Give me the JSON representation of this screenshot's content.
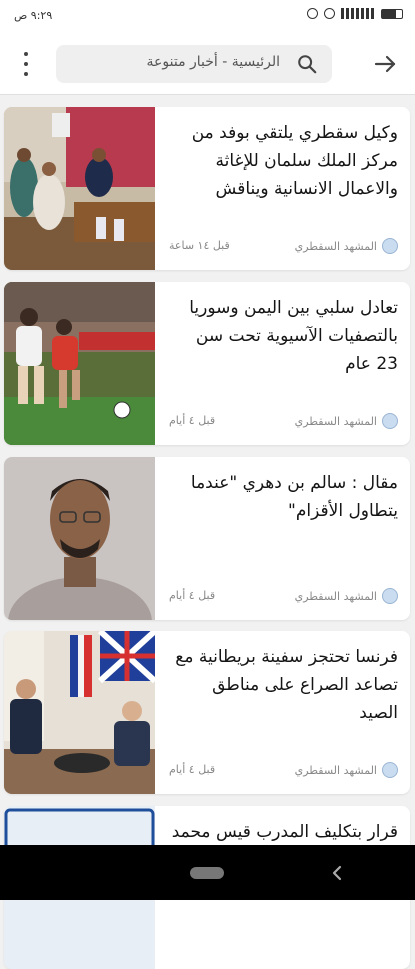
{
  "status_bar": {
    "time": "٩:٢٩ ص"
  },
  "header": {
    "search_text": "الرئيسية - أخبار متنوعة"
  },
  "articles": [
    {
      "title": "وكيل سقطري يلتقي بوفد من مركز الملك سلمان للإغاثة والاعمال الانسانية ويناقش",
      "source": "المشهد السقطري",
      "time": "قبل ١٤ ساعة"
    },
    {
      "title": "تعادل سلبي بين اليمن وسوريا بالتصفيات الآسيوية تحت سن 23 عام",
      "source": "المشهد السقطري",
      "time": "قبل ٤ أيام"
    },
    {
      "title": "مقال : سالم بن دهري \"عندما يتطاول الأقزام\"",
      "source": "المشهد السقطري",
      "time": "قبل ٤ أيام"
    },
    {
      "title": "فرنسا تحتجز سفينة بريطانية مع تصاعد الصراع على مناطق الصيد",
      "source": "المشهد السقطري",
      "time": "قبل ٤ أيام"
    },
    {
      "title": "قرار بتكليف المدرب قيس محمد",
      "source": "",
      "time": ""
    }
  ],
  "icons": {
    "menu": "more-vert-icon",
    "search": "search-icon",
    "back": "arrow-forward-icon",
    "source_logo": "source-logo-icon"
  },
  "colors": {
    "background": "#f1f1f1",
    "card": "#ffffff",
    "text": "#151515",
    "meta": "#888888"
  }
}
